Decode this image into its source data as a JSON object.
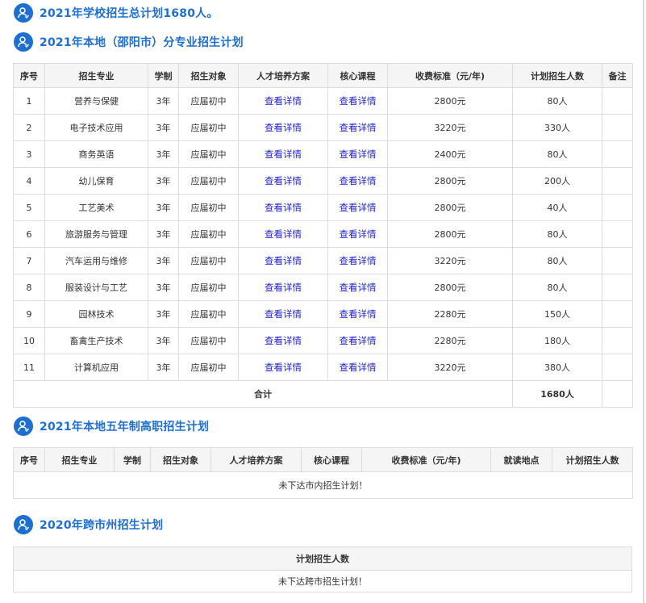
{
  "headline": "2021年学校招生总计划1680人。",
  "section1": {
    "title": "2021年本地（邵阳市）分专业招生计划",
    "columns": [
      "序号",
      "招生专业",
      "学制",
      "招生对象",
      "人才培养方案",
      "核心课程",
      "收费标准（元/年)",
      "计划招生人数",
      "备注"
    ],
    "rows": [
      {
        "no": "1",
        "major": "营养与保健",
        "duration": "3年",
        "target": "应届初中",
        "plan_link": "查看详情",
        "course_link": "查看详情",
        "fee": "2800元",
        "count": "80人",
        "note": ""
      },
      {
        "no": "2",
        "major": "电子技术应用",
        "duration": "3年",
        "target": "应届初中",
        "plan_link": "查看详情",
        "course_link": "查看详情",
        "fee": "3220元",
        "count": "330人",
        "note": ""
      },
      {
        "no": "3",
        "major": "商务英语",
        "duration": "3年",
        "target": "应届初中",
        "plan_link": "查看详情",
        "course_link": "查看详情",
        "fee": "2400元",
        "count": "80人",
        "note": ""
      },
      {
        "no": "4",
        "major": "幼儿保育",
        "duration": "3年",
        "target": "应届初中",
        "plan_link": "查看详情",
        "course_link": "查看详情",
        "fee": "2800元",
        "count": "200人",
        "note": ""
      },
      {
        "no": "5",
        "major": "工艺美术",
        "duration": "3年",
        "target": "应届初中",
        "plan_link": "查看详情",
        "course_link": "查看详情",
        "fee": "2800元",
        "count": "40人",
        "note": ""
      },
      {
        "no": "6",
        "major": "旅游服务与管理",
        "duration": "3年",
        "target": "应届初中",
        "plan_link": "查看详情",
        "course_link": "查看详情",
        "fee": "2800元",
        "count": "80人",
        "note": ""
      },
      {
        "no": "7",
        "major": "汽车运用与维修",
        "duration": "3年",
        "target": "应届初中",
        "plan_link": "查看详情",
        "course_link": "查看详情",
        "fee": "3220元",
        "count": "80人",
        "note": ""
      },
      {
        "no": "8",
        "major": "服装设计与工艺",
        "duration": "3年",
        "target": "应届初中",
        "plan_link": "查看详情",
        "course_link": "查看详情",
        "fee": "2800元",
        "count": "80人",
        "note": ""
      },
      {
        "no": "9",
        "major": "园林技术",
        "duration": "3年",
        "target": "应届初中",
        "plan_link": "查看详情",
        "course_link": "查看详情",
        "fee": "2280元",
        "count": "150人",
        "note": ""
      },
      {
        "no": "10",
        "major": "畜禽生产技术",
        "duration": "3年",
        "target": "应届初中",
        "plan_link": "查看详情",
        "course_link": "查看详情",
        "fee": "2280元",
        "count": "180人",
        "note": ""
      },
      {
        "no": "11",
        "major": "计算机应用",
        "duration": "3年",
        "target": "应届初中",
        "plan_link": "查看详情",
        "course_link": "查看详情",
        "fee": "3220元",
        "count": "380人",
        "note": ""
      }
    ],
    "total_label": "合计",
    "total_value": "1680人"
  },
  "section2": {
    "title": "2021年本地五年制高职招生计划",
    "columns": [
      "序号",
      "招生专业",
      "学制",
      "招生对象",
      "人才培养方案",
      "核心课程",
      "收费标准（元/年)",
      "就读地点",
      "计划招生人数"
    ],
    "empty_message": "未下达市内招生计划！"
  },
  "section3": {
    "title": "2020年跨市州招生计划",
    "column": "计划招生人数",
    "empty_message": "未下达跨市招生计划！"
  },
  "colors": {
    "accent": "#1f6fd1",
    "link": "#2222cc",
    "border": "#dcdcdc",
    "header_bg": "#f5f5f5"
  },
  "icons": {
    "section": "user-badge-icon"
  }
}
